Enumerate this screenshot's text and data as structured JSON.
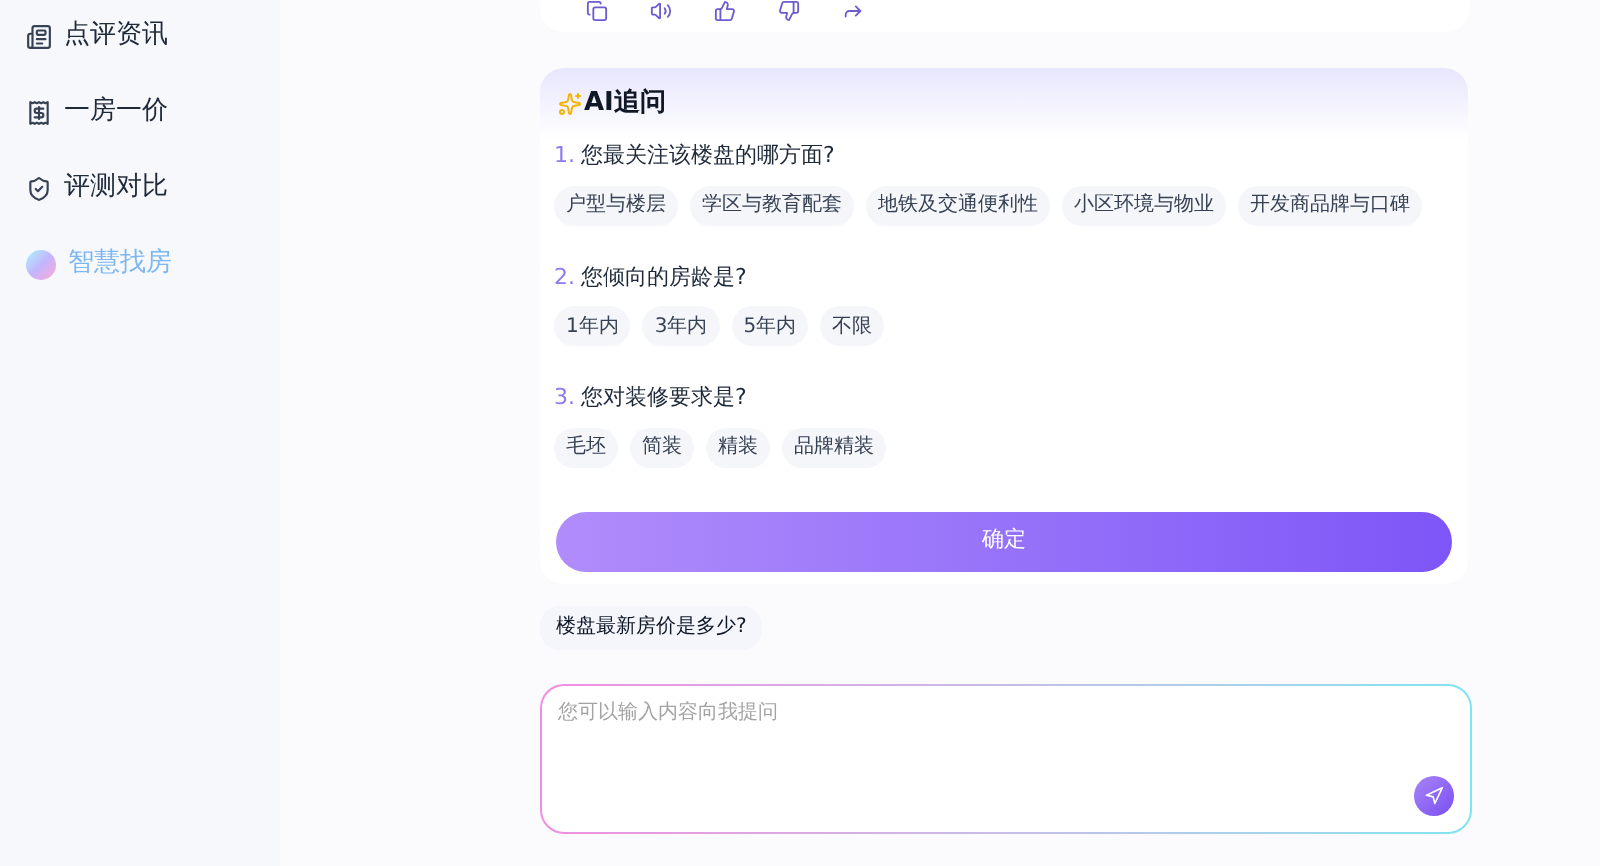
{
  "sidebar": {
    "items": [
      {
        "label": "点评资讯",
        "selected": false
      },
      {
        "label": "一房一价",
        "selected": false
      },
      {
        "label": "评测对比",
        "selected": false
      },
      {
        "label": "智慧找房",
        "selected": true
      }
    ]
  },
  "ai_followup": {
    "title": "AI追问",
    "questions": [
      {
        "number": "1.",
        "text": "您最关注该楼盘的哪方面?",
        "options": [
          "户型与楼层",
          "学区与教育配套",
          "地铁及交通便利性",
          "小区环境与物业",
          "开发商品牌与口碑"
        ]
      },
      {
        "number": "2.",
        "text": "您倾向的房龄是?",
        "options": [
          "1年内",
          "3年内",
          "5年内",
          "不限"
        ]
      },
      {
        "number": "3.",
        "text": "您对装修要求是?",
        "options": [
          "毛坯",
          "简装",
          "精装",
          "品牌精装"
        ]
      }
    ],
    "confirm_button": "确定"
  },
  "suggestion": "楼盘最新房价是多少?",
  "input": {
    "placeholder": "您可以输入内容向我提问"
  }
}
